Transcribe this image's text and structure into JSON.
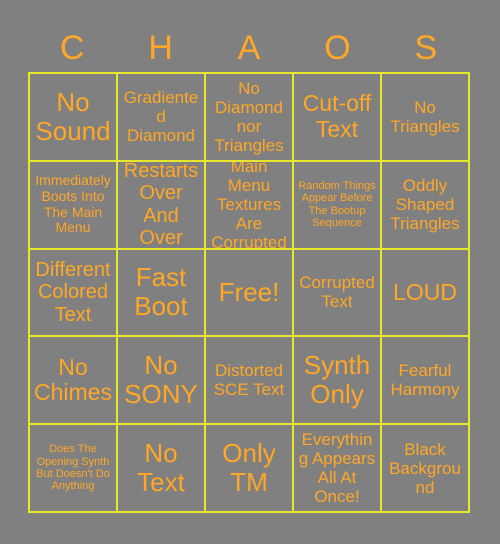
{
  "card": {
    "title_letters": [
      "C",
      "H",
      "A",
      "O",
      "S"
    ],
    "colors": {
      "background": "#808080",
      "grid_line": "#E8E82A",
      "text": "#FFA726"
    },
    "free_space_label": "Free!",
    "rows": [
      [
        {
          "text": "No Sound",
          "size": "xxl"
        },
        {
          "text": "Gradiented Diamond",
          "size": "md"
        },
        {
          "text": "No Diamond nor Triangles",
          "size": "md"
        },
        {
          "text": "Cut-off Text",
          "size": "xl"
        },
        {
          "text": "No Triangles",
          "size": "md"
        }
      ],
      [
        {
          "text": "Immediately Boots Into The Main Menu",
          "size": "sm"
        },
        {
          "text": "Restarts Over And Over",
          "size": "lg"
        },
        {
          "text": "Main Menu Textures Are Corrupted",
          "size": "md"
        },
        {
          "text": "Random Things Appear Before The Bootup Sequence",
          "size": "xs"
        },
        {
          "text": "Oddly Shaped Triangles",
          "size": "md"
        }
      ],
      [
        {
          "text": "Different Colored Text",
          "size": "lg"
        },
        {
          "text": "Fast Boot",
          "size": "xxl"
        },
        {
          "text": "Free!",
          "size": "xxl"
        },
        {
          "text": "Corrupted Text",
          "size": "md"
        },
        {
          "text": "LOUD",
          "size": "xl"
        }
      ],
      [
        {
          "text": "No Chimes",
          "size": "xl"
        },
        {
          "text": "No SONY",
          "size": "xxl"
        },
        {
          "text": "Distorted SCE Text",
          "size": "md"
        },
        {
          "text": "Synth Only",
          "size": "xxl"
        },
        {
          "text": "Fearful Harmony",
          "size": "md"
        }
      ],
      [
        {
          "text": "Does The Opening Synth But Doesn't Do Anything",
          "size": "xs"
        },
        {
          "text": "No Text",
          "size": "xxl"
        },
        {
          "text": "Only TM",
          "size": "xxl"
        },
        {
          "text": "Everything Appears All At Once!",
          "size": "md"
        },
        {
          "text": "Black Background",
          "size": "md"
        }
      ]
    ]
  }
}
